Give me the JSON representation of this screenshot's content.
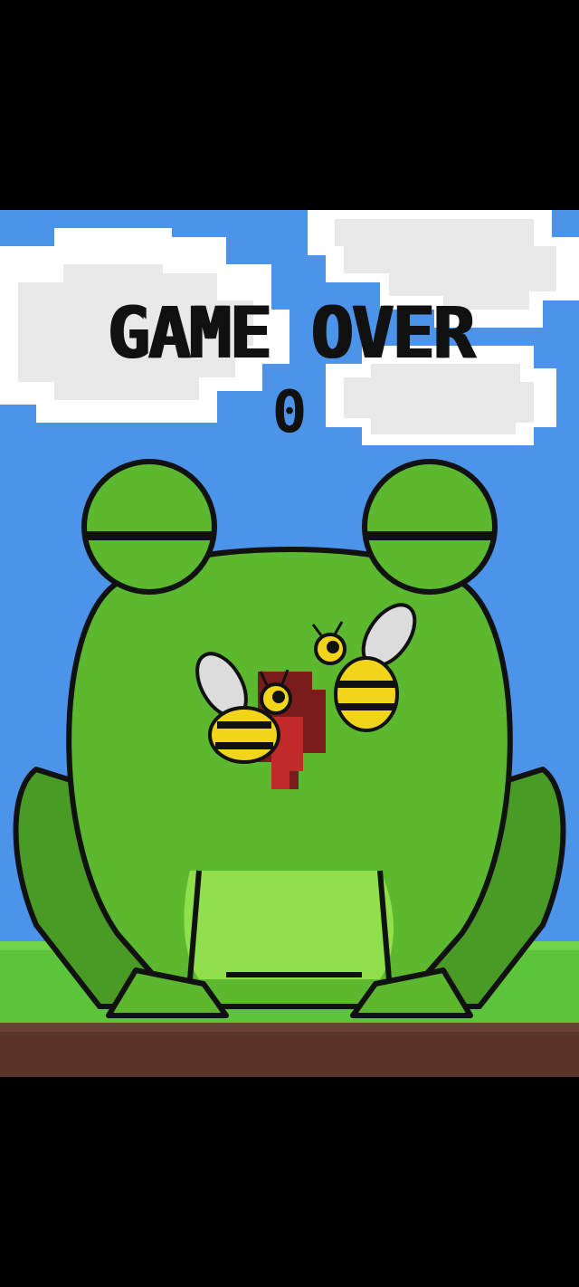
{
  "screen": {
    "title": "GAME OVER",
    "score": "0"
  },
  "colors": {
    "sky": "#4c94ea",
    "cloud": "#ececec",
    "cloud_edge": "#ffffff",
    "frog": "#5bb82f",
    "frog_belly": "#8fe04a",
    "frog_shadow": "#3f8f1f",
    "grass": "#5bc43a",
    "dirt": "#5a3428",
    "bee_yellow": "#f2d51a"
  },
  "icons": {
    "frog": "frog-icon",
    "bee": "bee-icon",
    "cloud": "cloud-icon"
  }
}
